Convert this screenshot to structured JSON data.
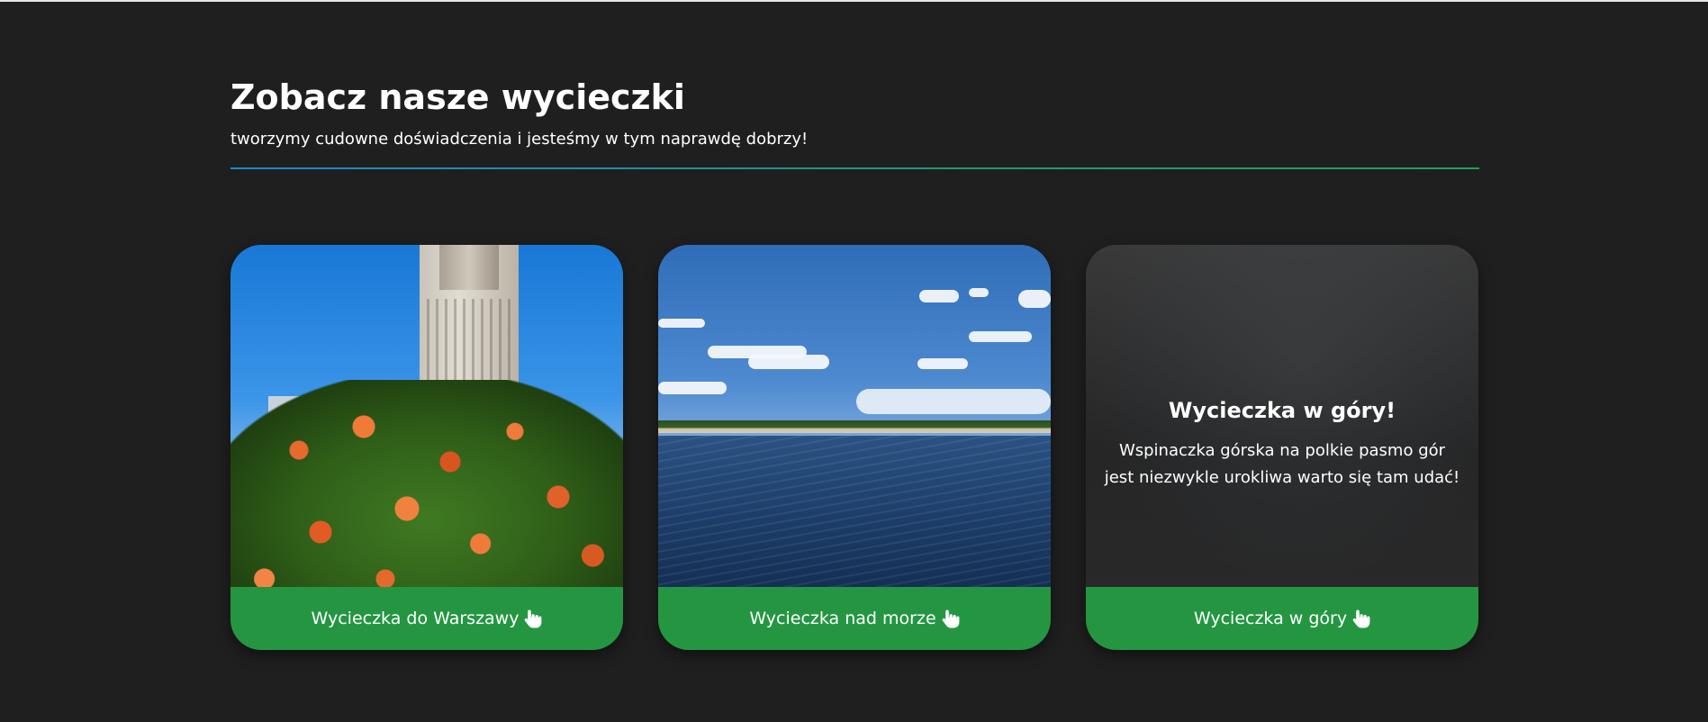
{
  "header": {
    "title": "Zobacz nasze wycieczki",
    "subtitle": "tworzymy cudowne doświadczenia i jesteśmy w tym naprawdę dobrzy!"
  },
  "cards": [
    {
      "label": "Wycieczka do Warszawy",
      "icon": "pointer-hand-icon"
    },
    {
      "label": "Wycieczka nad morze",
      "icon": "pointer-hand-icon"
    },
    {
      "label": "Wycieczka w góry",
      "icon": "pointer-hand-icon",
      "overlay_title": "Wycieczka w góry!",
      "overlay_text": "Wspinaczka górska na polkie pasmo gór jest niezwykle urokliwa warto się tam udać!"
    }
  ],
  "colors": {
    "background": "#1f1f1f",
    "button_green": "#249642",
    "divider_start": "#1a8ad1",
    "divider_end": "#22a05a"
  }
}
